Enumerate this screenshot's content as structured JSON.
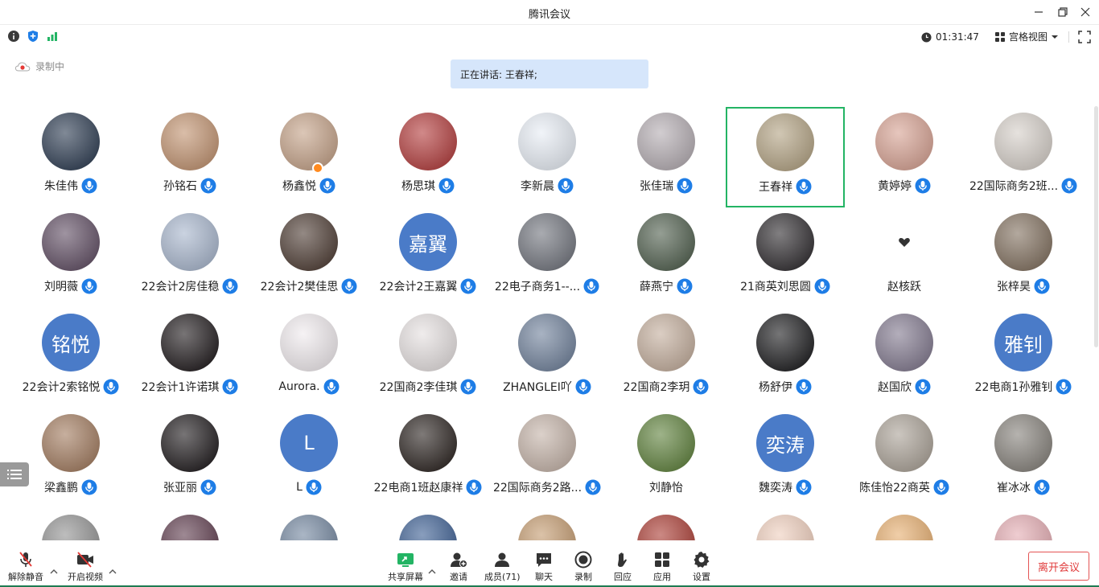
{
  "app": {
    "title": "腾讯会议"
  },
  "infobar": {
    "timer": "01:31:47",
    "view_mode": "宫格视图"
  },
  "recording": {
    "label": "录制中"
  },
  "speaking": {
    "text": "正在讲话: 王春祥;"
  },
  "participants": [
    {
      "name": "朱佳伟",
      "color": "#3c4a5e",
      "mic": true
    },
    {
      "name": "孙铭石",
      "color": "#c59a7a",
      "mic": true
    },
    {
      "name": "杨鑫悦",
      "color": "#c8a890",
      "mic": true,
      "host": true
    },
    {
      "name": "杨思琪",
      "color": "#b84a4a",
      "mic": true
    },
    {
      "name": "李新晨",
      "color": "#e9eef5",
      "mic": true
    },
    {
      "name": "张佳瑞",
      "color": "#b9b2b7",
      "mic": true
    },
    {
      "name": "王春祥",
      "color": "#b8a98c",
      "mic": true,
      "active": true
    },
    {
      "name": "黄婷婷",
      "color": "#d9a89a",
      "mic": true
    },
    {
      "name": "22国际商务2班...",
      "color": "#d8d2cc",
      "mic": true
    },
    {
      "name": "刘明薇",
      "color": "#6b5a6e",
      "mic": true
    },
    {
      "name": "22会计2房佳稳",
      "color": "#aebbd0",
      "mic": true
    },
    {
      "name": "22会计2樊佳思",
      "color": "#5a4a42",
      "mic": true
    },
    {
      "name": "22会计2王嘉翼",
      "letter": "嘉翼",
      "mic": true
    },
    {
      "name": "22电子商务1--...",
      "color": "#7b7e86",
      "mic": true
    },
    {
      "name": "薛燕宁",
      "color": "#5c6a5a",
      "mic": true
    },
    {
      "name": "21商英刘思圆",
      "color": "#3d3a3d",
      "mic": true
    },
    {
      "name": "赵核跃",
      "mic": false,
      "placeholder": true
    },
    {
      "name": "张梓昊",
      "color": "#8a7a6a",
      "mic": true
    },
    {
      "name": "22会计2索铭悦",
      "letter": "铭悦",
      "mic": true
    },
    {
      "name": "22会计1许诺琪",
      "color": "#2f2a2c",
      "mic": true
    },
    {
      "name": "Aurora.",
      "color": "#f1ecef",
      "mic": true
    },
    {
      "name": "22国商2李佳琪",
      "color": "#e7e2e2",
      "mic": true
    },
    {
      "name": "ZHANGLEI吖",
      "color": "#7a8aa2",
      "mic": true
    },
    {
      "name": "22国商2李玥",
      "color": "#c7b3a3",
      "mic": true
    },
    {
      "name": "杨舒伊",
      "color": "#2b2b2d",
      "mic": true
    },
    {
      "name": "赵国欣",
      "color": "#8a8296",
      "mic": true
    },
    {
      "name": "22电商1孙雅钊",
      "letter": "雅钊",
      "mic": true
    },
    {
      "name": "梁鑫鹏",
      "color": "#a8846a",
      "mic": true
    },
    {
      "name": "张亚丽",
      "color": "#2e2a2c",
      "mic": true
    },
    {
      "name": "L",
      "letter": "L",
      "mic": true
    },
    {
      "name": "22电商1班赵康祥",
      "color": "#3a3330",
      "mic": true
    },
    {
      "name": "22国际商务2路...",
      "color": "#c8b8ae",
      "mic": true
    },
    {
      "name": "刘静怡",
      "color": "#6a8a4a",
      "mic": false
    },
    {
      "name": "魏奕涛",
      "letter": "奕涛",
      "mic": true
    },
    {
      "name": "陈佳怡22商英",
      "color": "#b0a89e",
      "mic": true
    },
    {
      "name": "崔冰冰",
      "color": "#8e8a84",
      "mic": true
    },
    {
      "name": "",
      "color": "#9a9a9a",
      "mic": false
    },
    {
      "name": "",
      "color": "#6a4a5a",
      "mic": false
    },
    {
      "name": "",
      "color": "#7d8fa6",
      "mic": false
    },
    {
      "name": "",
      "color": "#4a6a9a",
      "mic": false
    },
    {
      "name": "",
      "color": "#c8a27a",
      "mic": false
    },
    {
      "name": "",
      "color": "#b04a42",
      "mic": false
    },
    {
      "name": "",
      "color": "#f0d2c2",
      "mic": false
    },
    {
      "name": "",
      "color": "#e8b47a",
      "mic": false
    },
    {
      "name": "",
      "color": "#e6b2b8",
      "mic": false
    }
  ],
  "toolbar": {
    "unmute": "解除静音",
    "start_video": "开启视频",
    "share_screen": "共享屏幕",
    "invite": "邀请",
    "members": "成员(71)",
    "chat": "聊天",
    "record": "录制",
    "reactions": "回应",
    "apps": "应用",
    "settings": "设置",
    "leave": "离开会议"
  },
  "colors": {
    "accent": "#1e7de6",
    "active_border": "#23b464",
    "leave": "#e03a3a",
    "letter_avatar": "#4a7bc8"
  }
}
